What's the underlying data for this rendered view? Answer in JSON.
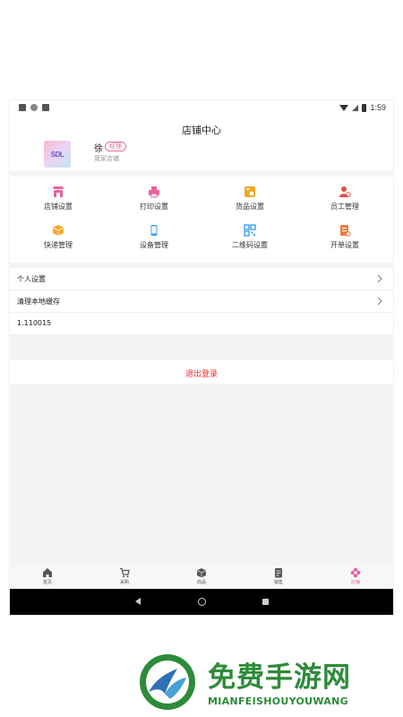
{
  "status_bar": {
    "time": "1:59"
  },
  "header": {
    "title": "店铺中心",
    "avatar_text": "SDL",
    "user_name": "徐",
    "role_badge": "经理",
    "store_name": "我家店铺"
  },
  "grid": {
    "items": [
      {
        "label": "店铺设置",
        "icon": "store-settings-icon",
        "color": "#e8639a"
      },
      {
        "label": "打印设置",
        "icon": "printer-icon",
        "color": "#e8639a"
      },
      {
        "label": "货品设置",
        "icon": "goods-settings-icon",
        "color": "#f5a623"
      },
      {
        "label": "员工管理",
        "icon": "staff-icon",
        "color": "#e84a4a"
      },
      {
        "label": "快递管理",
        "icon": "package-icon",
        "color": "#f5a623"
      },
      {
        "label": "设备管理",
        "icon": "phone-device-icon",
        "color": "#3aa0e8"
      },
      {
        "label": "二维码设置",
        "icon": "qrcode-icon",
        "color": "#3aa0e8"
      },
      {
        "label": "开单设置",
        "icon": "order-settings-icon",
        "color": "#f07a3a"
      }
    ]
  },
  "menu": {
    "personal_settings": "个人设置",
    "clear_cache": "清理本地缓存",
    "version": "1.110015"
  },
  "logout_label": "退出登录",
  "tabbar": {
    "tabs": [
      {
        "label": "首页",
        "icon": "home-icon"
      },
      {
        "label": "采购",
        "icon": "cart-icon"
      },
      {
        "label": "商品",
        "icon": "box-icon"
      },
      {
        "label": "销售",
        "icon": "receipt-icon"
      },
      {
        "label": "店铺",
        "icon": "flower-store-icon",
        "active": true
      }
    ],
    "active_color": "#e8639a"
  },
  "watermark": {
    "title": "免费手游网",
    "subtitle": "MIANFEISHOUYOUWANG",
    "color": "#2e8b3a"
  }
}
